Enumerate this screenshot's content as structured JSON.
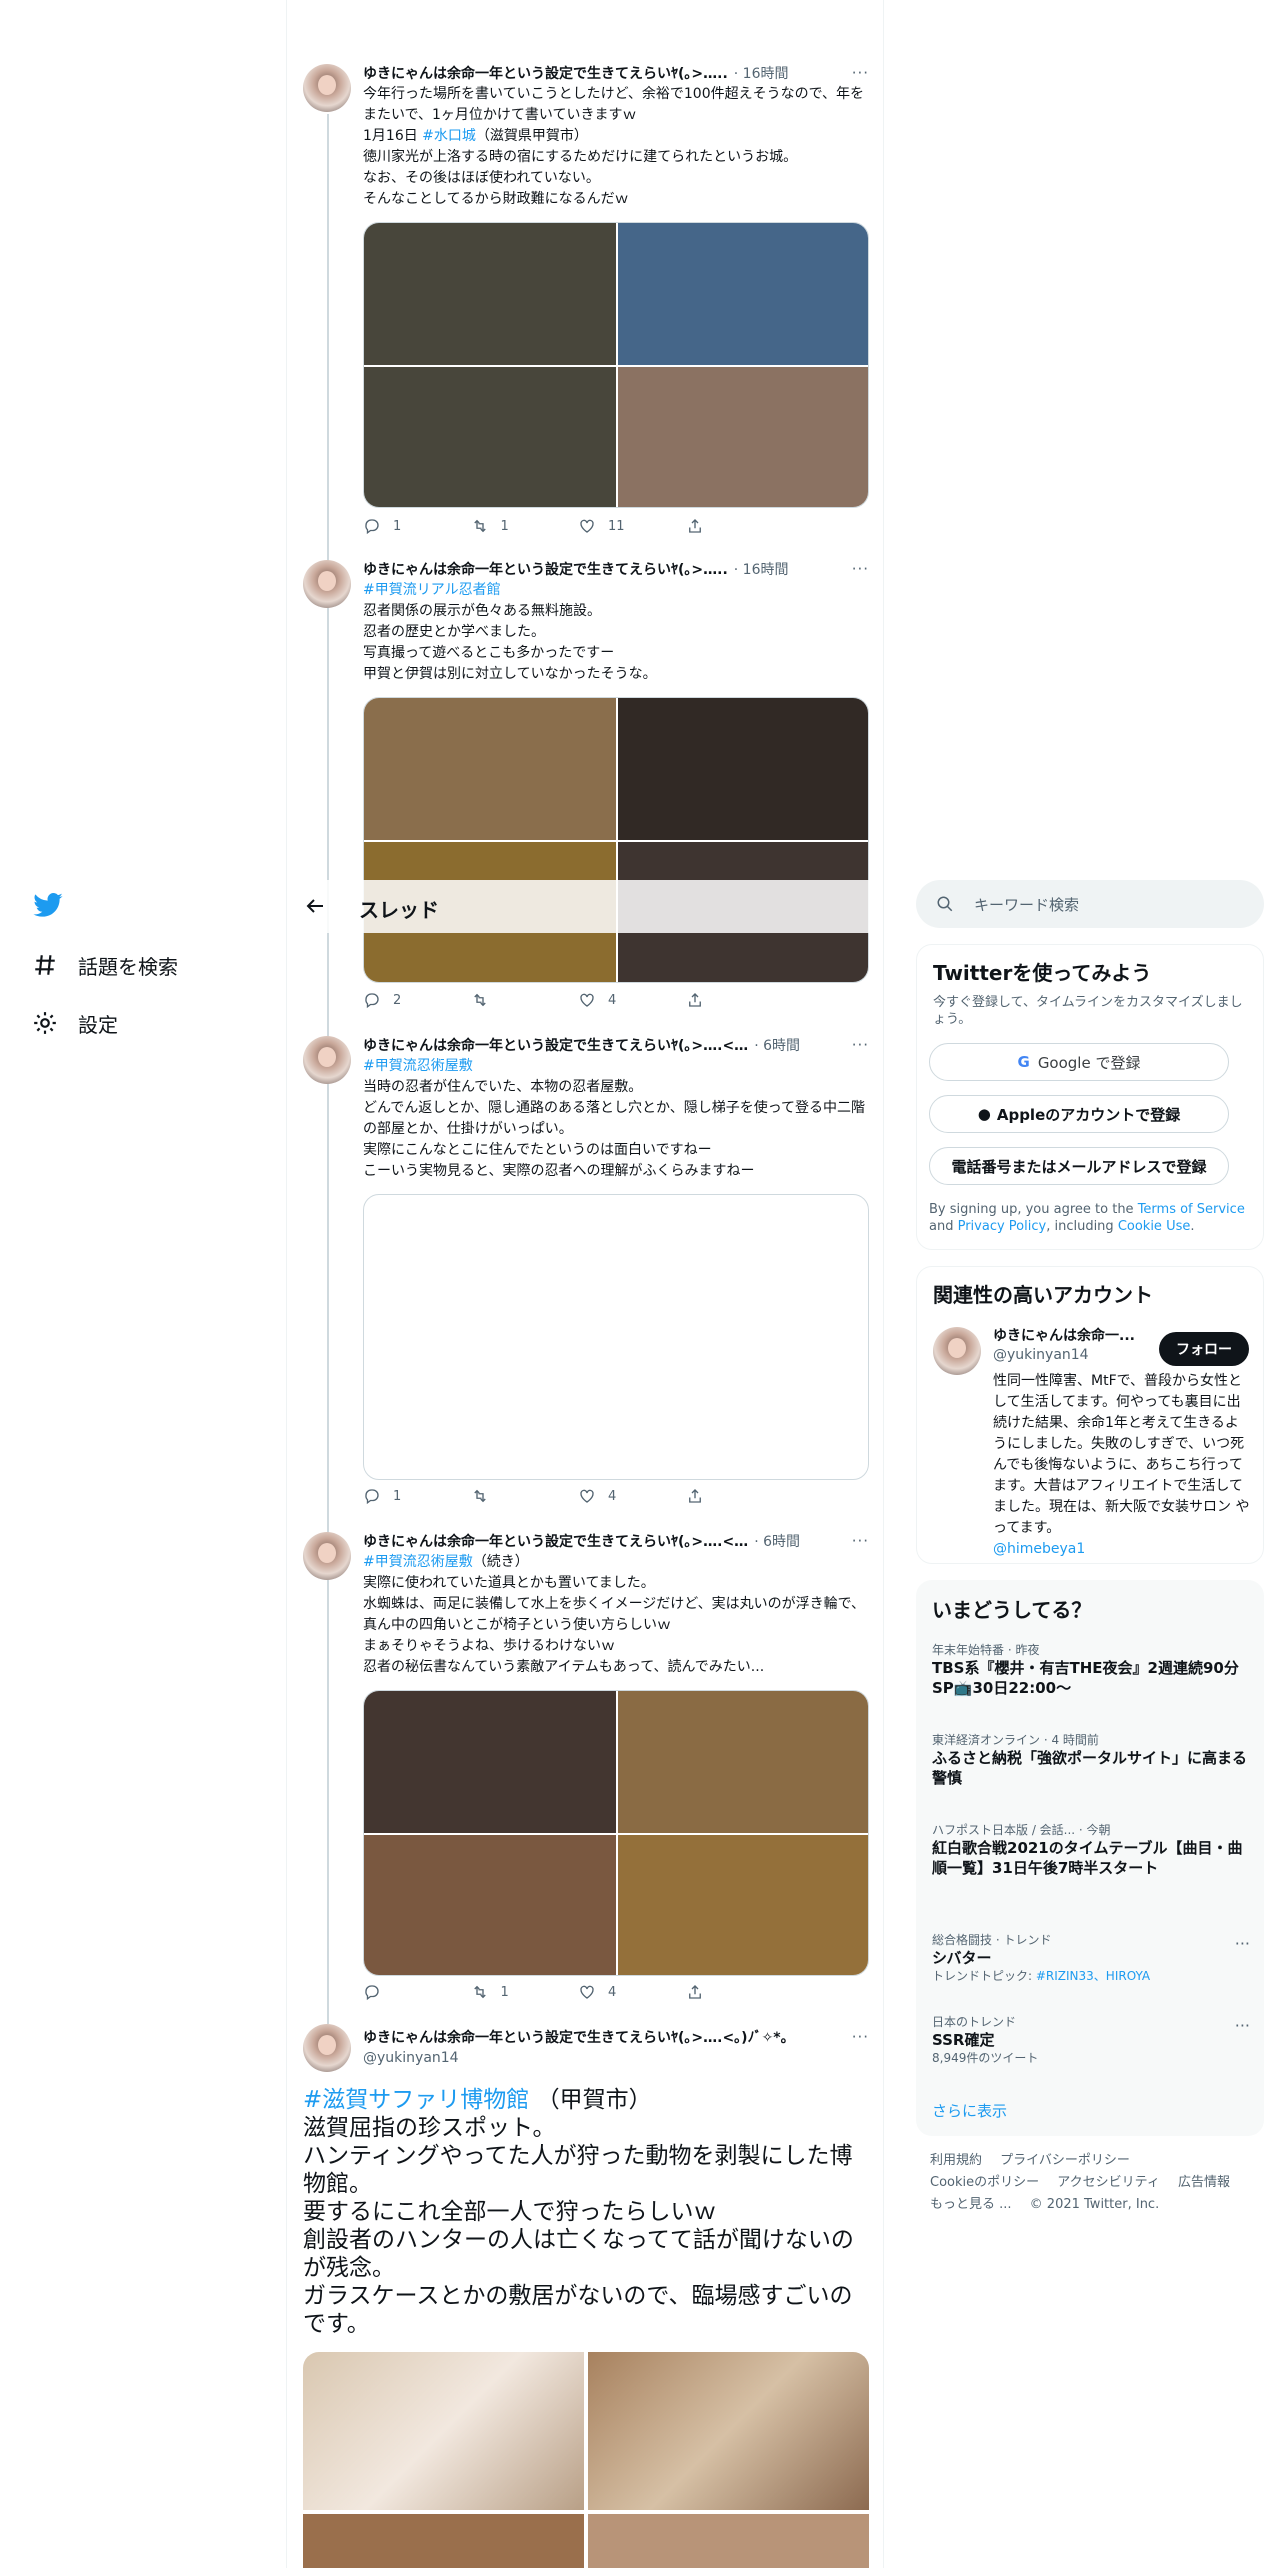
{
  "header": {
    "title": "スレッド"
  },
  "nav": {
    "explore": "話題を検索",
    "settings": "設定"
  },
  "search": {
    "placeholder": "キーワード検索"
  },
  "tweets": [
    {
      "name": "ゆきにゃんは余命一年という設定で生きてえらいﾔ(｡>…..",
      "time": "· 16時間",
      "text_a": "今年行った場所を書いていこうとしたけど、余裕で100件超えそうなので、年をまたいで、1ヶ月位かけて書いていきますｗ\n1月16日 ",
      "tag": "#水口城",
      "text_b": "（滋賀県甲賀市）\n徳川家光が上洛する時の宿にするためだけに建てられたというお城。\nなお、その後はほぼ使われていない。\nそんなことしてるから財政難になるんだｗ",
      "reply": "1",
      "retweet": "1",
      "like": "11"
    },
    {
      "name": "ゆきにゃんは余命一年という設定で生きてえらいﾔ(｡>…..",
      "time": "· 16時間",
      "tag": "#甲賀流リアル忍者館",
      "text_b": "忍者関係の展示が色々ある無料施設。\n忍者の歴史とか学べました。\n写真撮って遊べるとこも多かったですー\n甲賀と伊賀は別に対立していなかったそうな。",
      "reply": "2",
      "retweet": "",
      "like": "4"
    },
    {
      "name": "ゆきにゃんは余命一年という設定で生きてえらいﾔ(｡>….<…",
      "time": "· 6時間",
      "tag": "#甲賀流忍術屋敷",
      "text_b": "当時の忍者が住んでいた、本物の忍者屋敷。\nどんでん返しとか、隠し通路のある落とし穴とか、隠し梯子を使って登る中二階の部屋とか、仕掛けがいっぱい。\n実際にこんなとこに住んでたというのは面白いですねー\nこーいう実物見ると、実際の忍者への理解がふくらみますねー",
      "reply": "1",
      "retweet": "",
      "like": "4"
    },
    {
      "name": "ゆきにゃんは余命一年という設定で生きてえらいﾔ(｡>….<…",
      "time": "· 6時間",
      "tag": "#甲賀流忍術屋敷",
      "tag_suffix": "（続き）",
      "text_b": "実際に使われていた道具とかも置いてました。\n水蜘蛛は、両足に装備して水上を歩くイメージだけど、実は丸いのが浮き輪で、真ん中の四角いとこが椅子という使い方らしいｗ\nまぁそりゃそうよね、歩けるわけないｗ\n忍者の秘伝書なんていう素敵アイテムもあって、読んでみたい...",
      "reply": "",
      "retweet": "1",
      "like": "4"
    },
    {
      "name": "ゆきにゃんは余命一年という設定で生きてえらいﾔ(｡>….<｡)ﾉﾞ✧*。",
      "handle": "@yukinyan14",
      "tag": "#滋賀サファリ博物館",
      "text_a_suffix": "（甲賀市）",
      "text_b": "滋賀屈指の珍スポット。\nハンティングやってた人が狩った動物を剥製にした博物館。\n要するにこれ全部一人で狩ったらしいｗ\n創設者のハンターの人は亡くなってて話が聞けないのが残念。\nガラスケースとかの敷居がないので、臨場感すごいのです。"
    }
  ],
  "signup": {
    "title": "Twitterを使ってみよう",
    "sub": "今すぐ登録して、タイムラインをカスタマイズしましょう。",
    "google": "Google で登録",
    "apple": "Appleのアカウントで登録",
    "phone": "電話番号またはメールアドレスで登録",
    "legal_a": "By signing up, you agree to the ",
    "terms": "Terms of Service",
    "legal_b": " and ",
    "privacy": "Privacy Policy",
    "legal_c": ", including ",
    "cookie": "Cookie Use",
    "legal_d": "."
  },
  "related": {
    "title": "関連性の高いアカウント",
    "name": "ゆきにゃんは余命一...",
    "handle": "@yukinyan14",
    "follow": "フォロー",
    "bio": "性同一性障害、MtFで、普段から女性として生活してます。何やっても裏目に出続けた結果、余命1年と考えて生きるようにしました。失敗のしすぎで、いつ死んでも後悔ないように、あちこち行ってます。大昔はアフィリエイトで生活してました。現在は、新大阪で女装サロン やってます。",
    "mention": "@himebeya1"
  },
  "trends": {
    "title": "いまどうしてる？",
    "items": [
      {
        "meta": "年末年始特番 · 昨夜",
        "title": "TBS系『櫻井・有吉THE夜会』2週連続90分SP📺30日22:00〜"
      },
      {
        "meta": "東洋経済オンライン · 4 時間前",
        "title": "ふるさと納税「強欲ポータルサイト」に高まる警慎"
      },
      {
        "meta": "ハフポスト日本版 / 会話... · 今朝",
        "title": "紅白歌合戦2021のタイムテーブル【曲目・曲順一覧】31日午後7時半スタート"
      },
      {
        "meta": "総合格闘技 · トレンド",
        "title": "シバター",
        "sub_a": "トレンドトピック: ",
        "sub_tag": "#RIZIN33、HIROYA"
      },
      {
        "meta": "日本のトレンド",
        "title": "SSR確定",
        "count": "8,949件のツイート"
      }
    ],
    "more": "さらに表示"
  },
  "footer": {
    "links": [
      "利用規約",
      "プライバシーポリシー",
      "Cookieのポリシー",
      "アクセシビリティ",
      "広告情報",
      "もっと見る ..."
    ],
    "copyright": "© 2021 Twitter, Inc."
  },
  "colors": {
    "accent": "#1d9bf0",
    "text": "#0f1419",
    "muted": "#536471"
  }
}
